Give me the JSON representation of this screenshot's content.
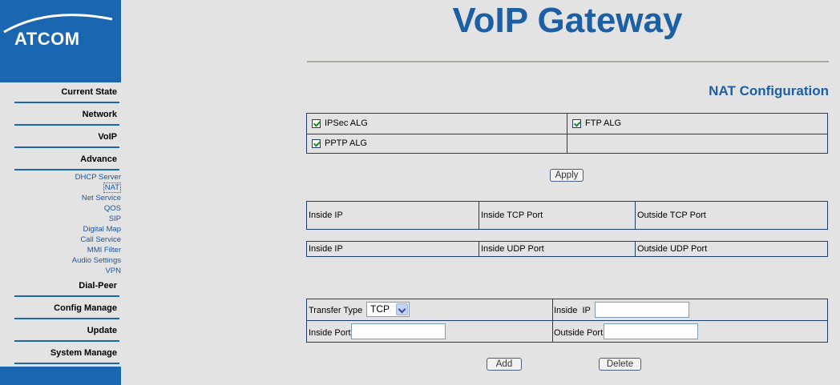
{
  "brand": {
    "logo_text": "ATCOM",
    "color": "#1a66b0"
  },
  "header": {
    "title": "VoIP Gateway",
    "section": "NAT Configuration"
  },
  "sidebar": {
    "main_top": [
      {
        "label": "Current State"
      },
      {
        "label": "Network"
      },
      {
        "label": "VoIP"
      },
      {
        "label": "Advance"
      }
    ],
    "sub_items": [
      {
        "label": "DHCP Server"
      },
      {
        "label": "NAT",
        "active": true
      },
      {
        "label": "Net Service"
      },
      {
        "label": "QOS"
      },
      {
        "label": "SIP"
      },
      {
        "label": "Digital Map"
      },
      {
        "label": "Call Service"
      },
      {
        "label": "MMI Filter"
      },
      {
        "label": "Audio Settings"
      },
      {
        "label": "VPN"
      }
    ],
    "main_bottom": [
      {
        "label": "Dial-Peer"
      },
      {
        "label": "Config Manage"
      },
      {
        "label": "Update"
      },
      {
        "label": "System Manage"
      }
    ]
  },
  "alg": {
    "ipsec": {
      "label": "IPSec ALG",
      "checked": true
    },
    "ftp": {
      "label": "FTP ALG",
      "checked": true
    },
    "pptp": {
      "label": "PPTP ALG",
      "checked": true
    }
  },
  "buttons": {
    "apply": "Apply",
    "add": "Add",
    "delete": "Delete"
  },
  "tcp_table": {
    "headers": [
      "Inside IP",
      "Inside TCP Port",
      "Outside TCP Port"
    ]
  },
  "udp_table": {
    "headers": [
      "Inside IP",
      "Inside UDP Port",
      "Outside UDP Port"
    ]
  },
  "form": {
    "transfer_type_label": "Transfer Type",
    "transfer_type_value": "TCP",
    "inside_ip_label": "Inside  IP",
    "inside_ip_value": "",
    "inside_port_label": "Inside Port",
    "inside_port_value": "",
    "outside_port_label": "Outside Port",
    "outside_port_value": ""
  }
}
